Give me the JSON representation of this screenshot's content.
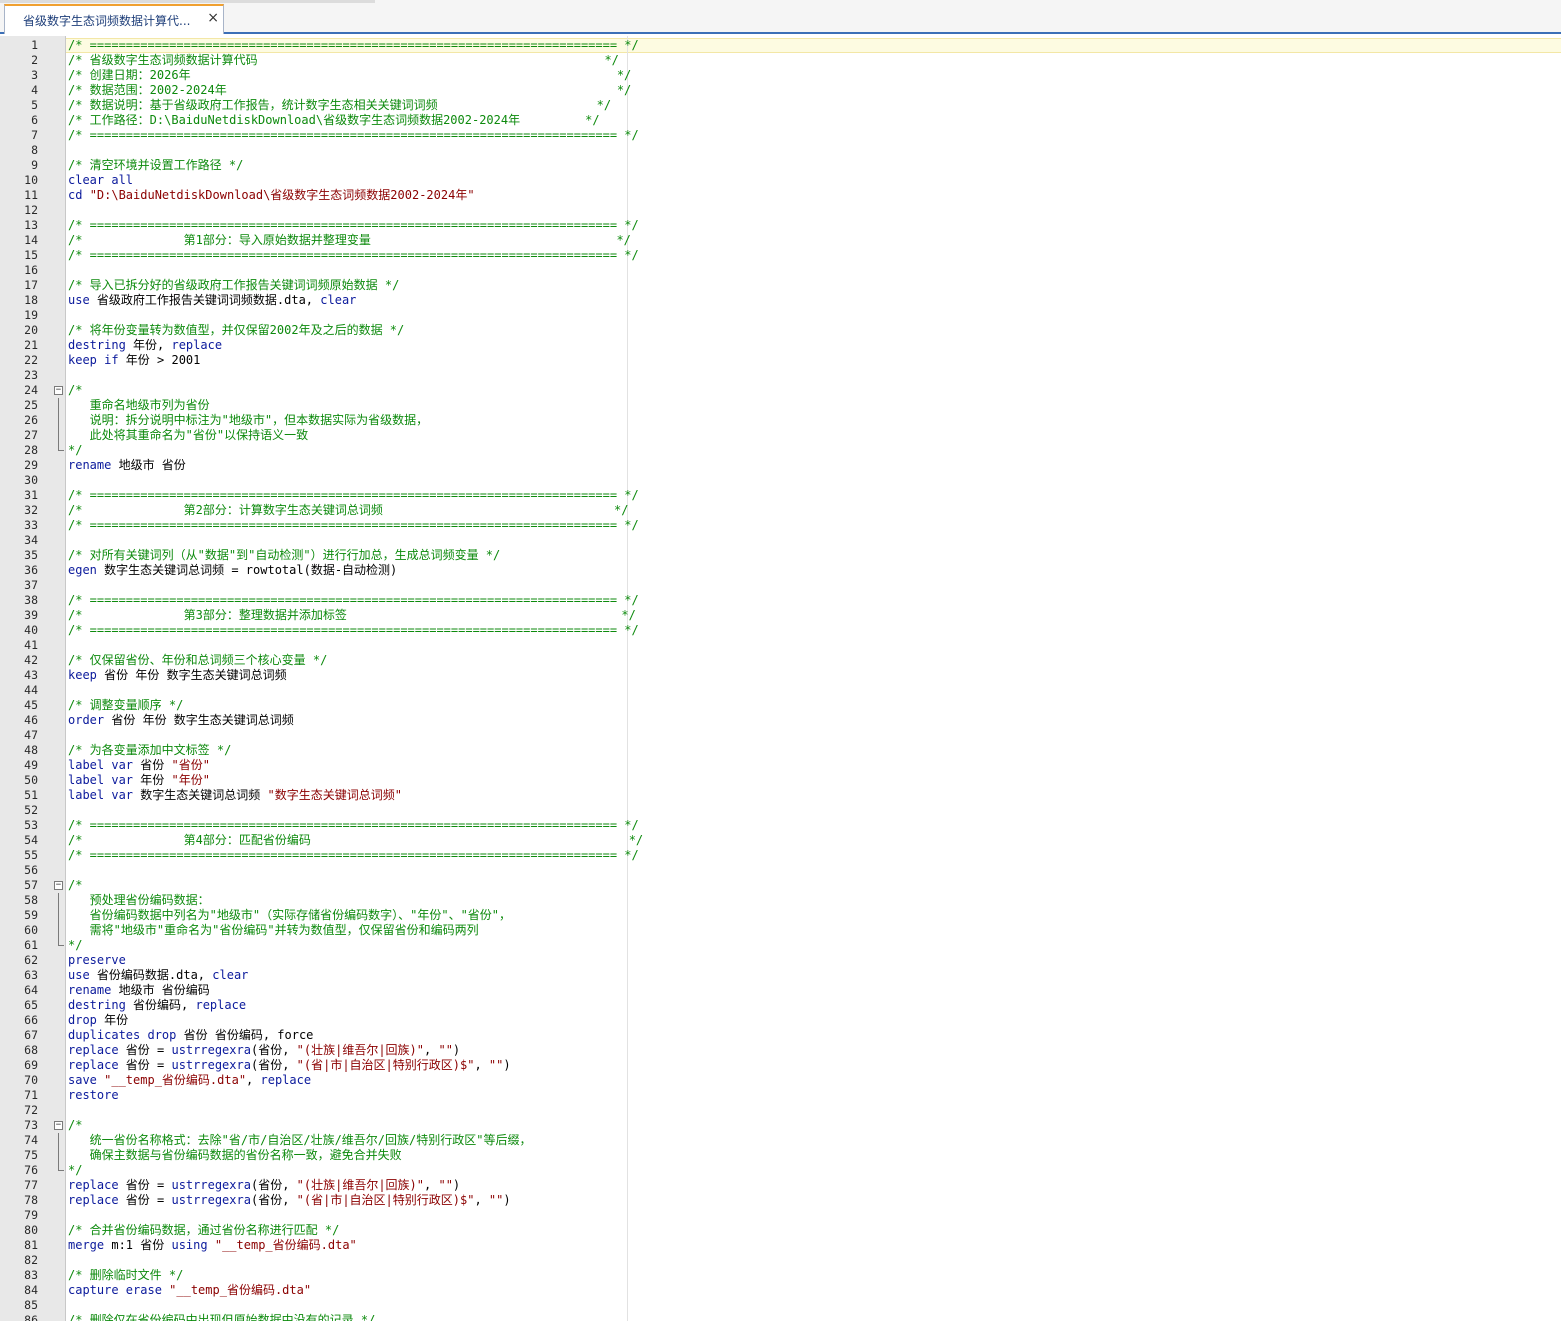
{
  "tab": {
    "title": "省级数字生态词频数据计算代...",
    "close_glyph": "×"
  },
  "editor": {
    "lines": [
      {
        "n": "1",
        "fold": "",
        "segs": [
          {
            "t": "c",
            "v": "/* ========================================================================= */"
          }
        ]
      },
      {
        "n": "2",
        "fold": "",
        "segs": [
          {
            "t": "c",
            "v": "/* 省级数字生态词频数据计算代码                                                */"
          }
        ]
      },
      {
        "n": "3",
        "fold": "",
        "segs": [
          {
            "t": "c",
            "v": "/* 创建日期：2026年                                                           */"
          }
        ]
      },
      {
        "n": "4",
        "fold": "",
        "segs": [
          {
            "t": "c",
            "v": "/* 数据范围：2002-2024年                                                      */"
          }
        ]
      },
      {
        "n": "5",
        "fold": "",
        "segs": [
          {
            "t": "c",
            "v": "/* 数据说明：基于省级政府工作报告，统计数字生态相关关键词词频                      */"
          }
        ]
      },
      {
        "n": "6",
        "fold": "",
        "segs": [
          {
            "t": "c",
            "v": "/* 工作路径：D:\\BaiduNetdiskDownload\\省级数字生态词频数据2002-2024年         */"
          }
        ]
      },
      {
        "n": "7",
        "fold": "",
        "segs": [
          {
            "t": "c",
            "v": "/* ========================================================================= */"
          }
        ]
      },
      {
        "n": "8",
        "fold": "",
        "segs": []
      },
      {
        "n": "9",
        "fold": "",
        "segs": [
          {
            "t": "c",
            "v": "/* 清空环境并设置工作路径 */"
          }
        ]
      },
      {
        "n": "10",
        "fold": "",
        "segs": [
          {
            "t": "k",
            "v": "clear all"
          }
        ]
      },
      {
        "n": "11",
        "fold": "",
        "segs": [
          {
            "t": "k",
            "v": "cd "
          },
          {
            "t": "s",
            "v": "\"D:\\BaiduNetdiskDownload\\省级数字生态词频数据2002-2024年\""
          }
        ]
      },
      {
        "n": "12",
        "fold": "",
        "segs": []
      },
      {
        "n": "13",
        "fold": "",
        "segs": [
          {
            "t": "c",
            "v": "/* ========================================================================= */"
          }
        ]
      },
      {
        "n": "14",
        "fold": "",
        "segs": [
          {
            "t": "c",
            "v": "/*              第1部分：导入原始数据并整理变量                                  */"
          }
        ]
      },
      {
        "n": "15",
        "fold": "",
        "segs": [
          {
            "t": "c",
            "v": "/* ========================================================================= */"
          }
        ]
      },
      {
        "n": "16",
        "fold": "",
        "segs": []
      },
      {
        "n": "17",
        "fold": "",
        "segs": [
          {
            "t": "c",
            "v": "/* 导入已拆分好的省级政府工作报告关键词词频原始数据 */"
          }
        ]
      },
      {
        "n": "18",
        "fold": "",
        "segs": [
          {
            "t": "k",
            "v": "use "
          },
          {
            "t": "t",
            "v": "省级政府工作报告关键词词频数据.dta, "
          },
          {
            "t": "k",
            "v": "clear"
          }
        ]
      },
      {
        "n": "19",
        "fold": "",
        "segs": []
      },
      {
        "n": "20",
        "fold": "",
        "segs": [
          {
            "t": "c",
            "v": "/* 将年份变量转为数值型，并仅保留2002年及之后的数据 */"
          }
        ]
      },
      {
        "n": "21",
        "fold": "",
        "segs": [
          {
            "t": "k",
            "v": "destring "
          },
          {
            "t": "t",
            "v": "年份, "
          },
          {
            "t": "k",
            "v": "replace"
          }
        ]
      },
      {
        "n": "22",
        "fold": "",
        "segs": [
          {
            "t": "k",
            "v": "keep if "
          },
          {
            "t": "t",
            "v": "年份 > 2001"
          }
        ]
      },
      {
        "n": "23",
        "fold": "",
        "segs": []
      },
      {
        "n": "24",
        "fold": "open",
        "segs": [
          {
            "t": "c",
            "v": "/*"
          }
        ]
      },
      {
        "n": "25",
        "fold": "bar",
        "segs": [
          {
            "t": "c",
            "v": "   重命名地级市列为省份"
          }
        ]
      },
      {
        "n": "26",
        "fold": "bar",
        "segs": [
          {
            "t": "c",
            "v": "   说明：拆分说明中标注为\"地级市\"，但本数据实际为省级数据，"
          }
        ]
      },
      {
        "n": "27",
        "fold": "bar",
        "segs": [
          {
            "t": "c",
            "v": "   此处将其重命名为\"省份\"以保持语义一致"
          }
        ]
      },
      {
        "n": "28",
        "fold": "end",
        "segs": [
          {
            "t": "c",
            "v": "*/"
          }
        ]
      },
      {
        "n": "29",
        "fold": "",
        "segs": [
          {
            "t": "k",
            "v": "rename "
          },
          {
            "t": "t",
            "v": "地级市 省份"
          }
        ]
      },
      {
        "n": "30",
        "fold": "",
        "segs": []
      },
      {
        "n": "31",
        "fold": "",
        "segs": [
          {
            "t": "c",
            "v": "/* ========================================================================= */"
          }
        ]
      },
      {
        "n": "32",
        "fold": "",
        "segs": [
          {
            "t": "c",
            "v": "/*              第2部分：计算数字生态关键词总词频                                */"
          }
        ]
      },
      {
        "n": "33",
        "fold": "",
        "segs": [
          {
            "t": "c",
            "v": "/* ========================================================================= */"
          }
        ]
      },
      {
        "n": "34",
        "fold": "",
        "segs": []
      },
      {
        "n": "35",
        "fold": "",
        "segs": [
          {
            "t": "c",
            "v": "/* 对所有关键词列（从\"数据\"到\"自动检测\"）进行行加总，生成总词频变量 */"
          }
        ]
      },
      {
        "n": "36",
        "fold": "",
        "segs": [
          {
            "t": "k",
            "v": "egen "
          },
          {
            "t": "t",
            "v": "数字生态关键词总词频 = rowtotal(数据-自动检测)"
          }
        ]
      },
      {
        "n": "37",
        "fold": "",
        "segs": []
      },
      {
        "n": "38",
        "fold": "",
        "segs": [
          {
            "t": "c",
            "v": "/* ========================================================================= */"
          }
        ]
      },
      {
        "n": "39",
        "fold": "",
        "segs": [
          {
            "t": "c",
            "v": "/*              第3部分：整理数据并添加标签                                      */"
          }
        ]
      },
      {
        "n": "40",
        "fold": "",
        "segs": [
          {
            "t": "c",
            "v": "/* ========================================================================= */"
          }
        ]
      },
      {
        "n": "41",
        "fold": "",
        "segs": []
      },
      {
        "n": "42",
        "fold": "",
        "segs": [
          {
            "t": "c",
            "v": "/* 仅保留省份、年份和总词频三个核心变量 */"
          }
        ]
      },
      {
        "n": "43",
        "fold": "",
        "segs": [
          {
            "t": "k",
            "v": "keep "
          },
          {
            "t": "t",
            "v": "省份 年份 数字生态关键词总词频"
          }
        ]
      },
      {
        "n": "44",
        "fold": "",
        "segs": []
      },
      {
        "n": "45",
        "fold": "",
        "segs": [
          {
            "t": "c",
            "v": "/* 调整变量顺序 */"
          }
        ]
      },
      {
        "n": "46",
        "fold": "",
        "segs": [
          {
            "t": "k",
            "v": "order "
          },
          {
            "t": "t",
            "v": "省份 年份 数字生态关键词总词频"
          }
        ]
      },
      {
        "n": "47",
        "fold": "",
        "segs": []
      },
      {
        "n": "48",
        "fold": "",
        "segs": [
          {
            "t": "c",
            "v": "/* 为各变量添加中文标签 */"
          }
        ]
      },
      {
        "n": "49",
        "fold": "",
        "segs": [
          {
            "t": "k",
            "v": "label var "
          },
          {
            "t": "t",
            "v": "省份 "
          },
          {
            "t": "s",
            "v": "\"省份\""
          }
        ]
      },
      {
        "n": "50",
        "fold": "",
        "segs": [
          {
            "t": "k",
            "v": "label var "
          },
          {
            "t": "t",
            "v": "年份 "
          },
          {
            "t": "s",
            "v": "\"年份\""
          }
        ]
      },
      {
        "n": "51",
        "fold": "",
        "segs": [
          {
            "t": "k",
            "v": "label var "
          },
          {
            "t": "t",
            "v": "数字生态关键词总词频 "
          },
          {
            "t": "s",
            "v": "\"数字生态关键词总词频\""
          }
        ]
      },
      {
        "n": "52",
        "fold": "",
        "segs": []
      },
      {
        "n": "53",
        "fold": "",
        "segs": [
          {
            "t": "c",
            "v": "/* ========================================================================= */"
          }
        ]
      },
      {
        "n": "54",
        "fold": "",
        "segs": [
          {
            "t": "c",
            "v": "/*              第4部分：匹配省份编码                                            */"
          }
        ]
      },
      {
        "n": "55",
        "fold": "",
        "segs": [
          {
            "t": "c",
            "v": "/* ========================================================================= */"
          }
        ]
      },
      {
        "n": "56",
        "fold": "",
        "segs": []
      },
      {
        "n": "57",
        "fold": "open",
        "segs": [
          {
            "t": "c",
            "v": "/*"
          }
        ]
      },
      {
        "n": "58",
        "fold": "bar",
        "segs": [
          {
            "t": "c",
            "v": "   预处理省份编码数据："
          }
        ]
      },
      {
        "n": "59",
        "fold": "bar",
        "segs": [
          {
            "t": "c",
            "v": "   省份编码数据中列名为\"地级市\"（实际存储省份编码数字）、\"年份\"、\"省份\"，"
          }
        ]
      },
      {
        "n": "60",
        "fold": "bar",
        "segs": [
          {
            "t": "c",
            "v": "   需将\"地级市\"重命名为\"省份编码\"并转为数值型，仅保留省份和编码两列"
          }
        ]
      },
      {
        "n": "61",
        "fold": "end",
        "segs": [
          {
            "t": "c",
            "v": "*/"
          }
        ]
      },
      {
        "n": "62",
        "fold": "",
        "segs": [
          {
            "t": "k",
            "v": "preserve"
          }
        ]
      },
      {
        "n": "63",
        "fold": "",
        "segs": [
          {
            "t": "k",
            "v": "use "
          },
          {
            "t": "t",
            "v": "省份编码数据.dta, "
          },
          {
            "t": "k",
            "v": "clear"
          }
        ]
      },
      {
        "n": "64",
        "fold": "",
        "segs": [
          {
            "t": "k",
            "v": "rename "
          },
          {
            "t": "t",
            "v": "地级市 省份编码"
          }
        ]
      },
      {
        "n": "65",
        "fold": "",
        "segs": [
          {
            "t": "k",
            "v": "destring "
          },
          {
            "t": "t",
            "v": "省份编码, "
          },
          {
            "t": "k",
            "v": "replace"
          }
        ]
      },
      {
        "n": "66",
        "fold": "",
        "segs": [
          {
            "t": "k",
            "v": "drop "
          },
          {
            "t": "t",
            "v": "年份"
          }
        ]
      },
      {
        "n": "67",
        "fold": "",
        "segs": [
          {
            "t": "k",
            "v": "duplicates drop "
          },
          {
            "t": "t",
            "v": "省份 省份编码, force"
          }
        ]
      },
      {
        "n": "68",
        "fold": "",
        "segs": [
          {
            "t": "k",
            "v": "replace "
          },
          {
            "t": "t",
            "v": "省份 = "
          },
          {
            "t": "k",
            "v": "ustrregexra"
          },
          {
            "t": "t",
            "v": "(省份, "
          },
          {
            "t": "s",
            "v": "\"(壮族|维吾尔|回族)\""
          },
          {
            "t": "t",
            "v": ", "
          },
          {
            "t": "s",
            "v": "\"\""
          },
          {
            "t": "t",
            "v": ")"
          }
        ]
      },
      {
        "n": "69",
        "fold": "",
        "segs": [
          {
            "t": "k",
            "v": "replace "
          },
          {
            "t": "t",
            "v": "省份 = "
          },
          {
            "t": "k",
            "v": "ustrregexra"
          },
          {
            "t": "t",
            "v": "(省份, "
          },
          {
            "t": "s",
            "v": "\"(省|市|自治区|特别行政区)$\""
          },
          {
            "t": "t",
            "v": ", "
          },
          {
            "t": "s",
            "v": "\"\""
          },
          {
            "t": "t",
            "v": ")"
          }
        ]
      },
      {
        "n": "70",
        "fold": "",
        "segs": [
          {
            "t": "k",
            "v": "save "
          },
          {
            "t": "s",
            "v": "\"__temp_省份编码.dta\""
          },
          {
            "t": "t",
            "v": ", "
          },
          {
            "t": "k",
            "v": "replace"
          }
        ]
      },
      {
        "n": "71",
        "fold": "",
        "segs": [
          {
            "t": "k",
            "v": "restore"
          }
        ]
      },
      {
        "n": "72",
        "fold": "",
        "segs": []
      },
      {
        "n": "73",
        "fold": "open",
        "segs": [
          {
            "t": "c",
            "v": "/*"
          }
        ]
      },
      {
        "n": "74",
        "fold": "bar",
        "segs": [
          {
            "t": "c",
            "v": "   统一省份名称格式：去除\"省/市/自治区/壮族/维吾尔/回族/特别行政区\"等后缀，"
          }
        ]
      },
      {
        "n": "75",
        "fold": "bar",
        "segs": [
          {
            "t": "c",
            "v": "   确保主数据与省份编码数据的省份名称一致，避免合并失败"
          }
        ]
      },
      {
        "n": "76",
        "fold": "end",
        "segs": [
          {
            "t": "c",
            "v": "*/"
          }
        ]
      },
      {
        "n": "77",
        "fold": "",
        "segs": [
          {
            "t": "k",
            "v": "replace "
          },
          {
            "t": "t",
            "v": "省份 = "
          },
          {
            "t": "k",
            "v": "ustrregexra"
          },
          {
            "t": "t",
            "v": "(省份, "
          },
          {
            "t": "s",
            "v": "\"(壮族|维吾尔|回族)\""
          },
          {
            "t": "t",
            "v": ", "
          },
          {
            "t": "s",
            "v": "\"\""
          },
          {
            "t": "t",
            "v": ")"
          }
        ]
      },
      {
        "n": "78",
        "fold": "",
        "segs": [
          {
            "t": "k",
            "v": "replace "
          },
          {
            "t": "t",
            "v": "省份 = "
          },
          {
            "t": "k",
            "v": "ustrregexra"
          },
          {
            "t": "t",
            "v": "(省份, "
          },
          {
            "t": "s",
            "v": "\"(省|市|自治区|特别行政区)$\""
          },
          {
            "t": "t",
            "v": ", "
          },
          {
            "t": "s",
            "v": "\"\""
          },
          {
            "t": "t",
            "v": ")"
          }
        ]
      },
      {
        "n": "79",
        "fold": "",
        "segs": []
      },
      {
        "n": "80",
        "fold": "",
        "segs": [
          {
            "t": "c",
            "v": "/* 合并省份编码数据，通过省份名称进行匹配 */"
          }
        ]
      },
      {
        "n": "81",
        "fold": "",
        "segs": [
          {
            "t": "k",
            "v": "merge "
          },
          {
            "t": "t",
            "v": "m:1 省份 "
          },
          {
            "t": "k",
            "v": "using "
          },
          {
            "t": "s",
            "v": "\"__temp_省份编码.dta\""
          }
        ]
      },
      {
        "n": "82",
        "fold": "",
        "segs": []
      },
      {
        "n": "83",
        "fold": "",
        "segs": [
          {
            "t": "c",
            "v": "/* 删除临时文件 */"
          }
        ]
      },
      {
        "n": "84",
        "fold": "",
        "segs": [
          {
            "t": "k",
            "v": "capture erase "
          },
          {
            "t": "s",
            "v": "\"__temp_省份编码.dta\""
          }
        ]
      },
      {
        "n": "85",
        "fold": "",
        "segs": []
      },
      {
        "n": "86",
        "fold": "",
        "segs": [
          {
            "t": "c",
            "v": "/* 删除仅在省份编码中出现但原始数据中没有的记录 */"
          }
        ]
      }
    ]
  }
}
